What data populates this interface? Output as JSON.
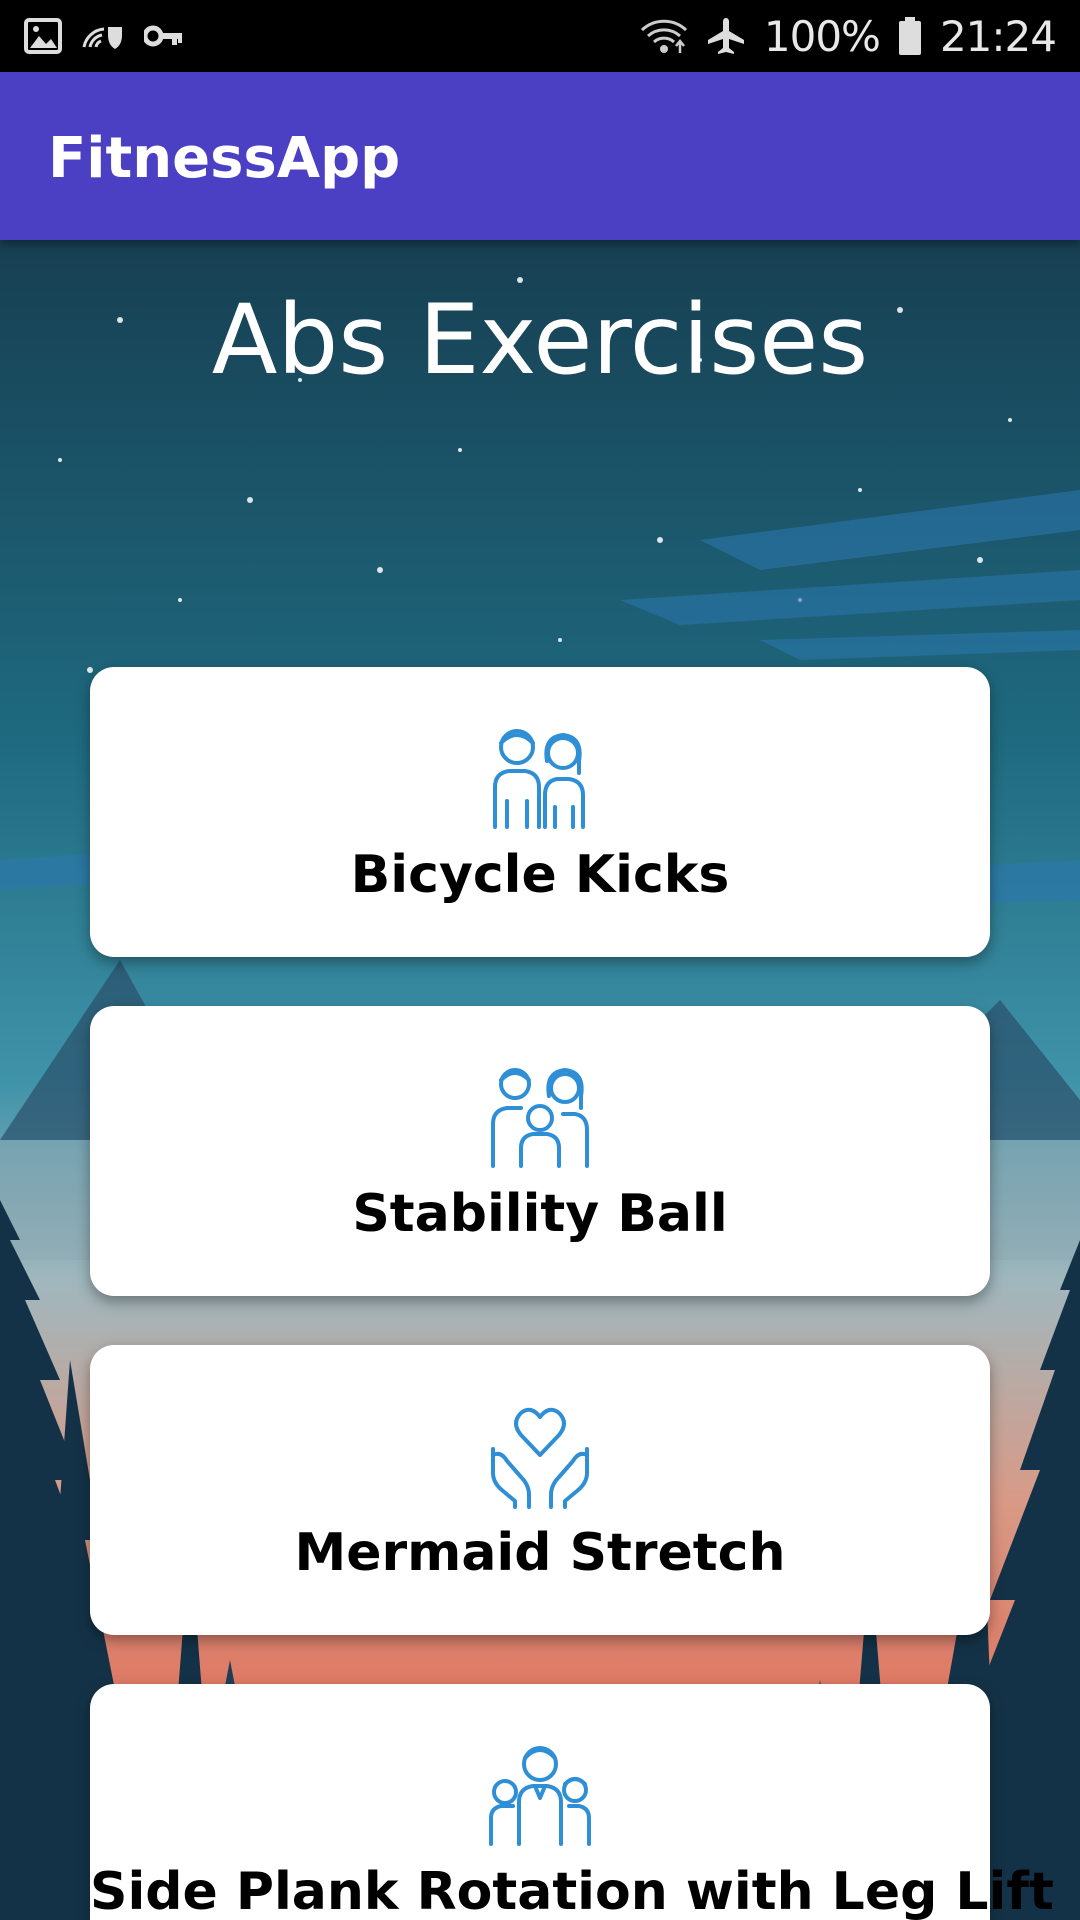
{
  "status_bar": {
    "battery": "100%",
    "time": "21:24"
  },
  "app_bar": {
    "title": "FitnessApp"
  },
  "heading": "Abs Exercises",
  "exercises": [
    {
      "label": "Bicycle Kicks",
      "icon": "couple-icon"
    },
    {
      "label": "Stability Ball",
      "icon": "family-icon"
    },
    {
      "label": "Mermaid Stretch",
      "icon": "hands-heart-icon"
    },
    {
      "label": "Side Plank Rotation with Leg Lift",
      "icon": "group-icon"
    }
  ],
  "colors": {
    "app_bar": "#4b40c4",
    "icon_blue": "#2f8fd6",
    "card": "#ffffff"
  }
}
